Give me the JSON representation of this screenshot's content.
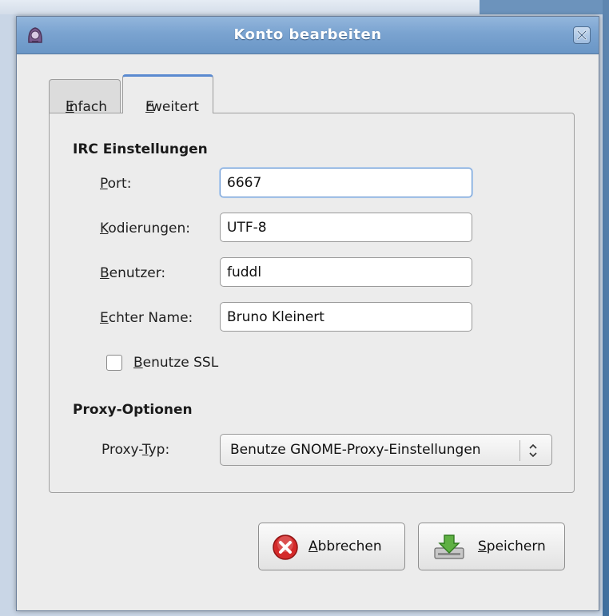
{
  "window": {
    "title": "Konto bearbeiten"
  },
  "tabs": [
    {
      "label": "Einfach",
      "accel": "E",
      "rest": "infach",
      "active": false
    },
    {
      "label": "Erweitert",
      "accel": "E",
      "rest": "rweitert",
      "active": true
    }
  ],
  "irc": {
    "heading": "IRC Einstellungen",
    "port": {
      "label": "Port:",
      "accel": "P",
      "rest": "ort:",
      "value": "6667"
    },
    "encoding": {
      "label": "Kodierungen:",
      "accel": "K",
      "rest": "odierungen:",
      "value": "UTF-8"
    },
    "user": {
      "label": "Benutzer:",
      "accel": "B",
      "rest": "enutzer:",
      "value": "fuddl"
    },
    "realname": {
      "label": "Echter Name:",
      "accel": "E",
      "rest": "chter Name:",
      "value": "Bruno Kleinert"
    },
    "ssl": {
      "label": "Benutze SSL",
      "accel": "B",
      "rest": "enutze SSL",
      "checked": false
    }
  },
  "proxy": {
    "heading": "Proxy-Optionen",
    "type_label_pre": "Proxy-",
    "type_label_accel": "T",
    "type_label_rest": "yp:",
    "selected": "Benutze GNOME-Proxy-Einstellungen"
  },
  "buttons": {
    "cancel": {
      "label": "Abbrechen",
      "accel": "A",
      "rest": "bbrechen"
    },
    "save": {
      "label": "Speichern",
      "accel": "S",
      "rest": "peichern"
    }
  },
  "colors": {
    "titlebar": "#7aa3d0",
    "focus": "#6e9bd4",
    "cancel_icon": "#d42a2a",
    "save_icon": "#5fb043"
  }
}
